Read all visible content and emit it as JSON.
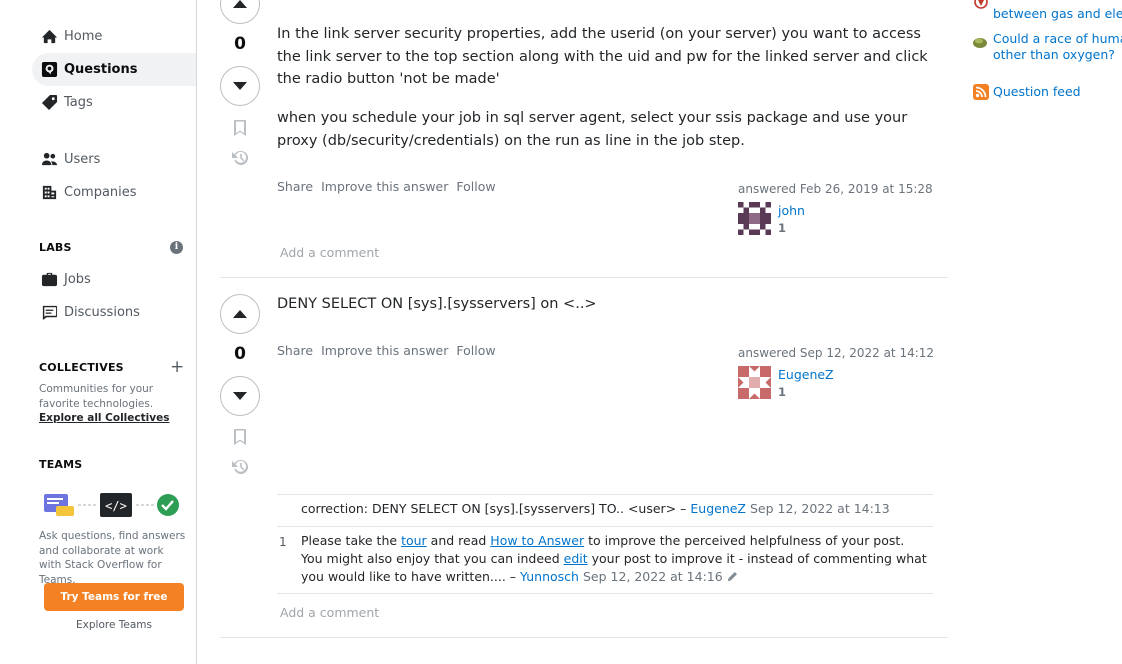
{
  "left_nav": {
    "home": "Home",
    "questions": "Questions",
    "tags": "Tags",
    "users": "Users",
    "companies": "Companies",
    "labs_heading": "LABS",
    "jobs": "Jobs",
    "discussions": "Discussions",
    "collectives_heading": "COLLECTIVES",
    "collectives_text": "Communities for your favorite technologies.",
    "collectives_link": "Explore all Collectives",
    "teams_heading": "TEAMS",
    "teams_text": "Ask questions, find answers and collaborate at work with Stack Overflow for Teams.",
    "teams_button": "Try Teams for free",
    "explore_teams": "Explore Teams"
  },
  "answer1": {
    "votes": "0",
    "para1": "In the link server security properties, add the userid (on your server) you want to access the link server to the top section along with the uid and pw for the linked server and click the radio button 'not be made'",
    "para2": "when you schedule your job in sql server agent, select your ssis package and use your proxy (db/security/credentials) on the run as line in the job step.",
    "share": "Share",
    "improve": "Improve this answer",
    "follow": "Follow",
    "answered": "answered Feb 26, 2019 at 15:28",
    "user": "john",
    "rep": "1",
    "add_comment": "Add a comment"
  },
  "answer2": {
    "votes": "0",
    "text": "DENY SELECT ON [sys].[sysservers] on <..>",
    "share": "Share",
    "improve": "Improve this answer",
    "follow": "Follow",
    "answered": "answered Sep 12, 2022 at 14:12",
    "user": "EugeneZ",
    "rep": "1",
    "comments": [
      {
        "score": "",
        "text": "correction: DENY SELECT ON [sys].[sysservers] TO.. <user> –",
        "user": "EugeneZ",
        "date": "Sep 12, 2022 at 14:13"
      },
      {
        "score": "1",
        "text_a": "Please take the",
        "link_tour": "tour",
        "text_b": "and read",
        "link_how": "How to Answer",
        "text_c": "to improve the perceived helpfulness of your post. You might also enjoy that you can indeed",
        "link_edit": "edit",
        "text_d": "your post to improve it - instead of commenting what you would like to have written.... –",
        "user": "Yunnosch",
        "date": "Sep 12, 2022 at 14:16"
      }
    ],
    "add_comment": "Add a comment"
  },
  "right_sidebar": {
    "hot1_text": "Why did Jurassic Park el... between gas and electric",
    "hot1_line2": "between gas and electric",
    "hot2_text": "Could a race of humanoi... other than oxygen?",
    "hot2_line1": "Could a race of humanoi",
    "hot2_line2": "other than oxygen?",
    "question_feed": "Question feed"
  }
}
